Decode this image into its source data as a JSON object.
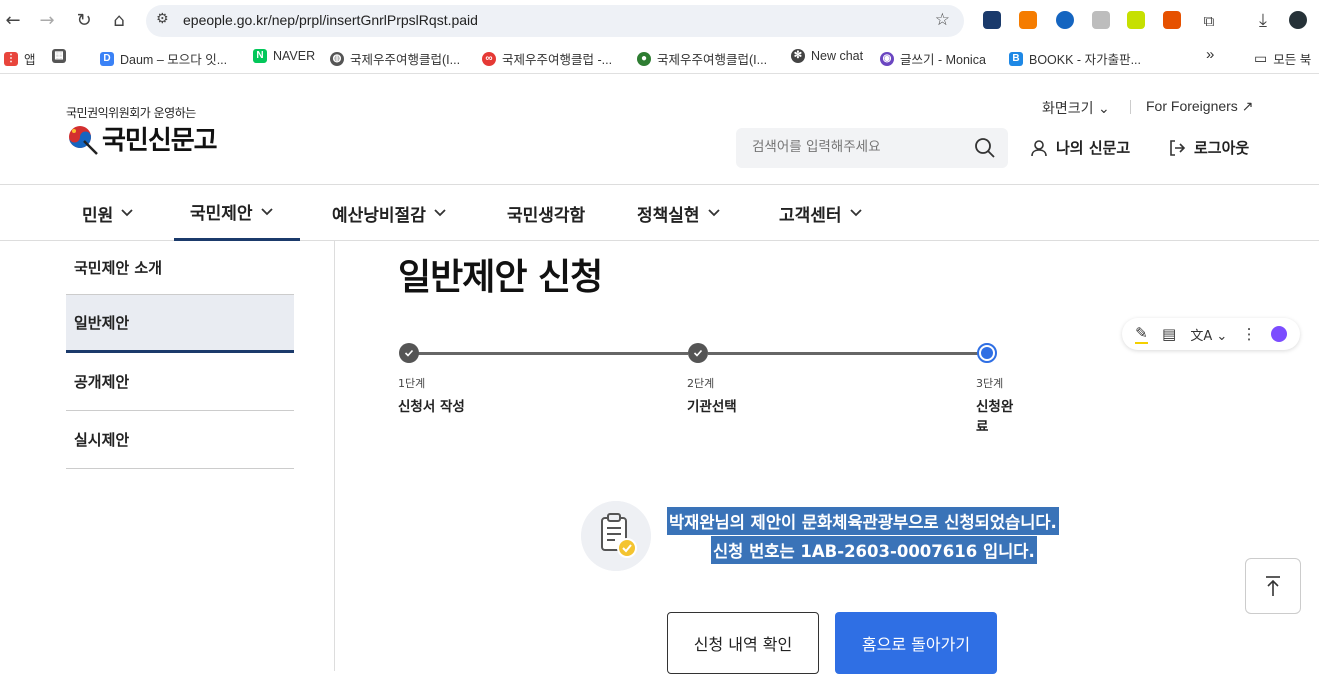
{
  "browser": {
    "url": "epeople.go.kr/nep/prpl/insertGnrlPrpslRqst.paid",
    "bookmarks": [
      {
        "label": "앱",
        "icon": "apps-grid-icon",
        "color": "#e8453c"
      },
      {
        "label": "",
        "icon": "tab-groups-icon",
        "color": "#555555"
      },
      {
        "label": "Daum – 모으다 잇...",
        "icon": "daum-icon",
        "color": "#3b82f6"
      },
      {
        "label": "NAVER",
        "icon": "naver-icon",
        "color": "#03c75a"
      },
      {
        "label": "국제우주여행클럽(I...",
        "icon": "globe-icon",
        "color": "#555555"
      },
      {
        "label": "국제우주여행클럽 -...",
        "icon": "club-icon",
        "color": "#e53935"
      },
      {
        "label": "국제우주여행클럽(I...",
        "icon": "leaf-icon",
        "color": "#2e7d32"
      },
      {
        "label": "New chat",
        "icon": "openai-icon",
        "color": "#444444"
      },
      {
        "label": "글쓰기 - Monica",
        "icon": "monica-icon",
        "color": "#6b46c1"
      },
      {
        "label": "BOOKK - 자가출판...",
        "icon": "bookk-icon",
        "color": "#1e88e5"
      }
    ],
    "more": "»",
    "all_bookmarks": "모든 북"
  },
  "site": {
    "logo_sub": "국민권익위원회가 운영하는",
    "logo_main": "국민신문고",
    "zoom_label": "화면크기",
    "foreigners_label": "For Foreigners",
    "search_placeholder": "검색어를 입력해주세요",
    "my_label": "나의 신문고",
    "logout_label": "로그아웃"
  },
  "gnb": [
    {
      "label": "민원",
      "has_menu": true
    },
    {
      "label": "국민제안",
      "has_menu": true,
      "active": true
    },
    {
      "label": "예산낭비절감",
      "has_menu": true
    },
    {
      "label": "국민생각함",
      "has_menu": false
    },
    {
      "label": "정책실현",
      "has_menu": true
    },
    {
      "label": "고객센터",
      "has_menu": true
    }
  ],
  "sidebar": [
    {
      "label": "국민제안 소개"
    },
    {
      "label": "일반제안",
      "active": true
    },
    {
      "label": "공개제안"
    },
    {
      "label": "실시제안"
    }
  ],
  "main": {
    "title": "일반제안 신청",
    "steps": [
      {
        "num": "1단계",
        "name": "신청서 작성",
        "state": "done"
      },
      {
        "num": "2단계",
        "name": "기관선택",
        "state": "done"
      },
      {
        "num": "3단계",
        "name": "신청완료",
        "state": "current"
      }
    ],
    "message_line1": "박재완님의 제안이 문화체육관광부으로 신청되었습니다.",
    "message_line2": "신청 번호는 1AB-2603-0007616 입니다.",
    "btn_history": "신청 내역 확인",
    "btn_home": "홈으로 돌아가기"
  },
  "colors": {
    "accent": "#2f6fe4",
    "navy": "#1b3a6b",
    "highlight": "#3a73b8"
  }
}
